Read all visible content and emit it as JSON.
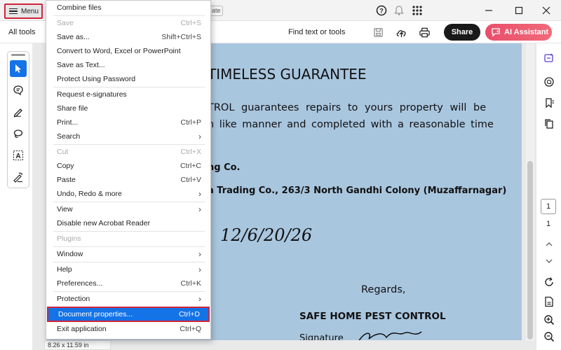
{
  "topbar": {
    "menu_label": "Menu",
    "tab_fragment": "ate",
    "icons": [
      "help-icon",
      "bell-icon",
      "apps-grid-icon",
      "minimize-icon",
      "maximize-icon",
      "close-icon"
    ]
  },
  "toolbar": {
    "all_tools": "All tools",
    "find_text": "Find text or tools",
    "share": "Share",
    "ai_assistant": "AI Assistant"
  },
  "left_tools": [
    "select-arrow-icon",
    "comment-icon",
    "draw-pen-icon",
    "lasso-icon",
    "text-recognition-icon",
    "sign-icon"
  ],
  "menu": {
    "items": [
      {
        "label": "Combine files",
        "shortcut": "",
        "arrow": false,
        "disabled": false
      },
      {
        "label": "Save",
        "shortcut": "Ctrl+S",
        "arrow": false,
        "disabled": true
      },
      {
        "label": "Save as...",
        "shortcut": "Shift+Ctrl+S",
        "arrow": false,
        "disabled": false
      },
      {
        "label": "Convert to Word, Excel or PowerPoint",
        "shortcut": "",
        "arrow": false,
        "disabled": false
      },
      {
        "label": "Save as Text...",
        "shortcut": "",
        "arrow": false,
        "disabled": false
      },
      {
        "label": "Protect Using Password",
        "shortcut": "",
        "arrow": false,
        "disabled": false
      },
      {
        "label": "Request e-signatures",
        "shortcut": "",
        "arrow": false,
        "disabled": false
      },
      {
        "label": "Share file",
        "shortcut": "",
        "arrow": false,
        "disabled": false
      },
      {
        "label": "Print...",
        "shortcut": "Ctrl+P",
        "arrow": false,
        "disabled": false
      },
      {
        "label": "Search",
        "shortcut": "",
        "arrow": true,
        "disabled": false
      },
      {
        "label": "Cut",
        "shortcut": "Ctrl+X",
        "arrow": false,
        "disabled": true
      },
      {
        "label": "Copy",
        "shortcut": "Ctrl+C",
        "arrow": false,
        "disabled": false
      },
      {
        "label": "Paste",
        "shortcut": "Ctrl+V",
        "arrow": false,
        "disabled": false
      },
      {
        "label": "Undo, Redo & more",
        "shortcut": "",
        "arrow": true,
        "disabled": false
      },
      {
        "label": "View",
        "shortcut": "",
        "arrow": true,
        "disabled": false
      },
      {
        "label": "Disable new Acrobat Reader",
        "shortcut": "",
        "arrow": false,
        "disabled": false
      },
      {
        "label": "Plugins",
        "shortcut": "",
        "arrow": false,
        "disabled": true
      },
      {
        "label": "Window",
        "shortcut": "",
        "arrow": true,
        "disabled": false
      },
      {
        "label": "Help",
        "shortcut": "",
        "arrow": true,
        "disabled": false
      },
      {
        "label": "Preferences...",
        "shortcut": "Ctrl+K",
        "arrow": false,
        "disabled": false
      },
      {
        "label": "Protection",
        "shortcut": "",
        "arrow": true,
        "disabled": false
      },
      {
        "label": "Document properties...",
        "shortcut": "Ctrl+D",
        "arrow": false,
        "disabled": false,
        "selected": true
      },
      {
        "label": "Exit application",
        "shortcut": "Ctrl+Q",
        "arrow": false,
        "disabled": false
      }
    ]
  },
  "document": {
    "heading": "TIMELESS GUARANTEE",
    "line1": "TROL guarantees repairs to yours property will be",
    "line2": "n like manner and completed with a reasonable time",
    "line3": "ng Co.",
    "line4": "a Trading  Co., 263/3 North Gandhi Colony (Muzaffarnagar)",
    "handwritten_date": "12/6/20/26",
    "regards": "Regards,",
    "company": "SAFE HOME PEST CONTROL",
    "signature_label": "Signature"
  },
  "status": {
    "page_size": "8.26 x 11.59 in"
  },
  "pagination": {
    "current": "1",
    "total": "1"
  },
  "right_tools": [
    "ai-sparkle-icon",
    "comment-bubble-icon",
    "bookmark-icon",
    "copy-pages-icon",
    "chevron-up-icon",
    "chevron-down-icon",
    "refresh-icon",
    "page-fit-icon",
    "zoom-in-icon",
    "zoom-out-icon"
  ]
}
